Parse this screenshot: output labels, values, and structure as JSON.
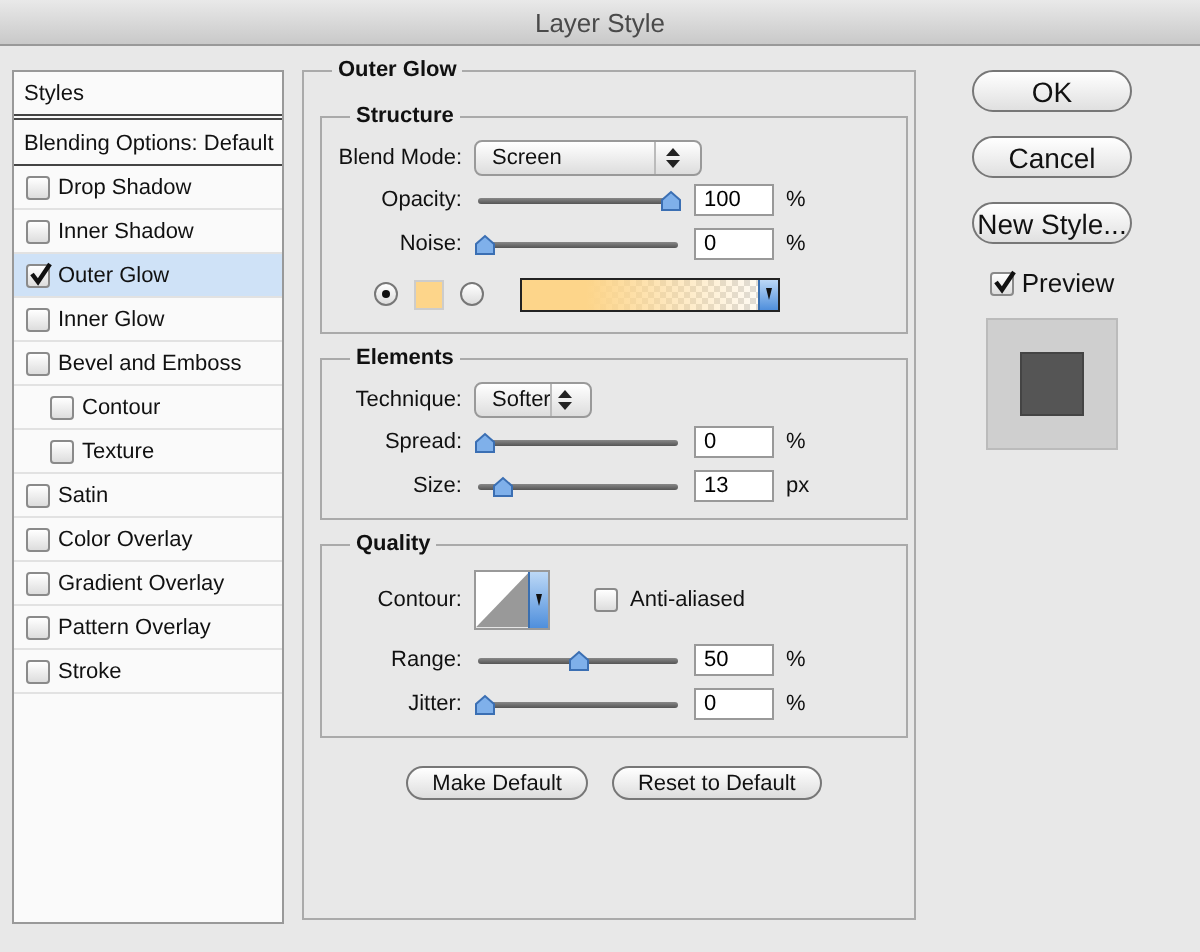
{
  "window": {
    "title": "Layer Style"
  },
  "sidebar": {
    "title": "Styles",
    "blending_options": "Blending Options: Default",
    "items": [
      {
        "label": "Drop Shadow",
        "checked": false,
        "selected": false
      },
      {
        "label": "Inner Shadow",
        "checked": false,
        "selected": false
      },
      {
        "label": "Outer Glow",
        "checked": true,
        "selected": true
      },
      {
        "label": "Inner Glow",
        "checked": false,
        "selected": false
      },
      {
        "label": "Bevel and Emboss",
        "checked": false,
        "selected": false,
        "children": [
          {
            "label": "Contour",
            "checked": false,
            "selected": false
          },
          {
            "label": "Texture",
            "checked": false,
            "selected": false
          }
        ]
      },
      {
        "label": "Satin",
        "checked": false,
        "selected": false
      },
      {
        "label": "Color Overlay",
        "checked": false,
        "selected": false
      },
      {
        "label": "Gradient Overlay",
        "checked": false,
        "selected": false
      },
      {
        "label": "Pattern Overlay",
        "checked": false,
        "selected": false
      },
      {
        "label": "Stroke",
        "checked": false,
        "selected": false
      }
    ]
  },
  "panel": {
    "title": "Outer Glow",
    "groups": [
      {
        "title": "Structure",
        "rows": [
          {
            "kind": "select",
            "label": "Blend Mode:",
            "value": "Screen",
            "wide": true
          },
          {
            "kind": "slider",
            "label": "Opacity:",
            "level": 1,
            "value": "100",
            "unit": "%"
          },
          {
            "kind": "slider",
            "label": "Noise:",
            "level": 0,
            "value": "0",
            "unit": "%"
          },
          {
            "kind": "color",
            "options": [
              {
                "kind": "solid",
                "selected": true
              },
              {
                "kind": "gradient",
                "selected": false
              }
            ]
          }
        ]
      },
      {
        "title": "Elements",
        "rows": [
          {
            "kind": "select",
            "label": "Technique:",
            "value": "Softer",
            "wide": false
          },
          {
            "kind": "slider",
            "label": "Spread:",
            "level": 0,
            "value": "0",
            "unit": "%"
          },
          {
            "kind": "slider",
            "label": "Size:",
            "level": 0.1,
            "value": "13",
            "unit": "px"
          }
        ]
      },
      {
        "title": "Quality",
        "rows": [
          {
            "kind": "contour",
            "label": "Contour:",
            "checkbox": {
              "label": "Anti-aliased",
              "checked": false
            }
          },
          {
            "kind": "slider",
            "label": "Range:",
            "level": 0.5,
            "value": "50",
            "unit": "%"
          },
          {
            "kind": "slider",
            "label": "Jitter:",
            "level": 0,
            "value": "0",
            "unit": "%"
          }
        ]
      }
    ],
    "buttons": [
      "Make Default",
      "Reset to Default"
    ]
  },
  "actions": {
    "buttons": [
      "OK",
      "Cancel",
      "New Style..."
    ],
    "preview": {
      "label": "Preview",
      "checked": true
    }
  }
}
